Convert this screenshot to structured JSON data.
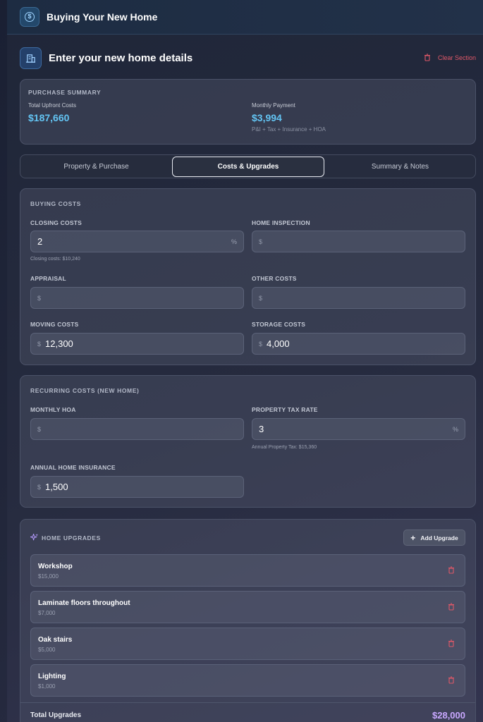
{
  "header": {
    "title": "Buying Your New Home",
    "icon": "dollar-icon"
  },
  "section": {
    "title": "Enter your new home details",
    "icon": "building-icon",
    "clear_label": "Clear Section"
  },
  "summary": {
    "label": "PURCHASE SUMMARY",
    "upfront_label": "Total Upfront Costs",
    "upfront_value": "$187,660",
    "monthly_label": "Monthly Payment",
    "monthly_value": "$3,994",
    "monthly_sub": "P&I + Tax + Insurance + HOA"
  },
  "tabs": [
    {
      "label": "Property & Purchase",
      "active": false
    },
    {
      "label": "Costs & Upgrades",
      "active": true
    },
    {
      "label": "Summary & Notes",
      "active": false
    }
  ],
  "buying_costs": {
    "label": "BUYING COSTS",
    "closing": {
      "label": "CLOSING COSTS",
      "value": "2",
      "unit": "%",
      "note": "Closing costs: $10,240"
    },
    "inspection": {
      "label": "HOME INSPECTION",
      "placeholder": "$"
    },
    "appraisal": {
      "label": "APPRAISAL",
      "placeholder": "$"
    },
    "other": {
      "label": "OTHER COSTS",
      "placeholder": "$"
    },
    "moving": {
      "label": "MOVING COSTS",
      "currency": "$",
      "value": "12,300"
    },
    "storage": {
      "label": "STORAGE COSTS",
      "currency": "$",
      "value": "4,000"
    }
  },
  "recurring": {
    "label": "RECURRING COSTS (NEW HOME)",
    "hoa": {
      "label": "MONTHLY HOA",
      "placeholder": "$"
    },
    "tax": {
      "label": "PROPERTY TAX RATE",
      "value": "3",
      "unit": "%",
      "note": "Annual Property Tax: $15,360"
    },
    "insurance": {
      "label": "ANNUAL HOME INSURANCE",
      "currency": "$",
      "value": "1,500"
    }
  },
  "upgrades": {
    "label": "HOME UPGRADES",
    "add_label": "Add Upgrade",
    "items": [
      {
        "name": "Workshop",
        "cost": "$15,000"
      },
      {
        "name": "Laminate floors throughout",
        "cost": "$7,000"
      },
      {
        "name": "Oak stairs",
        "cost": "$5,000"
      },
      {
        "name": "Lighting",
        "cost": "$1,000"
      }
    ],
    "total_label": "Total Upgrades",
    "total_value": "$28,000"
  },
  "colors": {
    "accent_blue": "#63c4f3",
    "accent_purple": "#c9a8ff",
    "danger": "#e05868"
  }
}
